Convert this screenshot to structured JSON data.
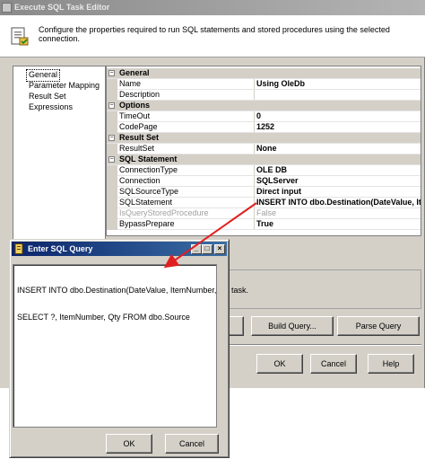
{
  "window": {
    "title": "Execute SQL Task Editor"
  },
  "header": {
    "text": "Configure the properties required to run SQL statements and stored procedures using the selected connection."
  },
  "left_nav": {
    "items": [
      {
        "label": "General",
        "selected": true
      },
      {
        "label": "Parameter Mapping",
        "selected": false
      },
      {
        "label": "Result Set",
        "selected": false
      },
      {
        "label": "Expressions",
        "selected": false
      }
    ]
  },
  "grid": {
    "rows": [
      {
        "kind": "category",
        "name": "General"
      },
      {
        "kind": "prop",
        "name": "Name",
        "value": "Using OleDb"
      },
      {
        "kind": "prop",
        "name": "Description",
        "value": ""
      },
      {
        "kind": "category",
        "name": "Options"
      },
      {
        "kind": "prop",
        "name": "TimeOut",
        "value": "0"
      },
      {
        "kind": "prop",
        "name": "CodePage",
        "value": "1252"
      },
      {
        "kind": "category",
        "name": "Result Set"
      },
      {
        "kind": "prop",
        "name": "ResultSet",
        "value": "None"
      },
      {
        "kind": "category",
        "name": "SQL Statement"
      },
      {
        "kind": "prop",
        "name": "ConnectionType",
        "value": "OLE DB"
      },
      {
        "kind": "prop",
        "name": "Connection",
        "value": "SQLServer"
      },
      {
        "kind": "prop",
        "name": "SQLSourceType",
        "value": "Direct input"
      },
      {
        "kind": "prop",
        "name": "SQLStatement",
        "value": "INSERT INTO dbo.Destination(DateValue, Ite"
      },
      {
        "kind": "prop",
        "name": "IsQueryStoredProcedure",
        "value": "False",
        "disabled": true
      },
      {
        "kind": "prop",
        "name": "BypassPrepare",
        "value": "True"
      }
    ]
  },
  "description_fragment": "task.",
  "buttons": {
    "build_query": "Build Query...",
    "parse_query": "Parse Query",
    "ok": "OK",
    "cancel": "Cancel",
    "help": "Help"
  },
  "dialog": {
    "title": "Enter SQL Query",
    "sql_lines": [
      "INSERT INTO dbo.Destination(DateValue, ItemNumber, Qty)",
      "SELECT ?, ItemNumber, Qty FROM dbo.Source"
    ],
    "ok": "OK",
    "cancel": "Cancel",
    "minimize_glyph": "_",
    "maximize_glyph": "□",
    "close_glyph": "×"
  },
  "colors": {
    "arrow": "#e02020",
    "active_title": "#0a246a",
    "inactive_title": "#8a8a8a"
  }
}
